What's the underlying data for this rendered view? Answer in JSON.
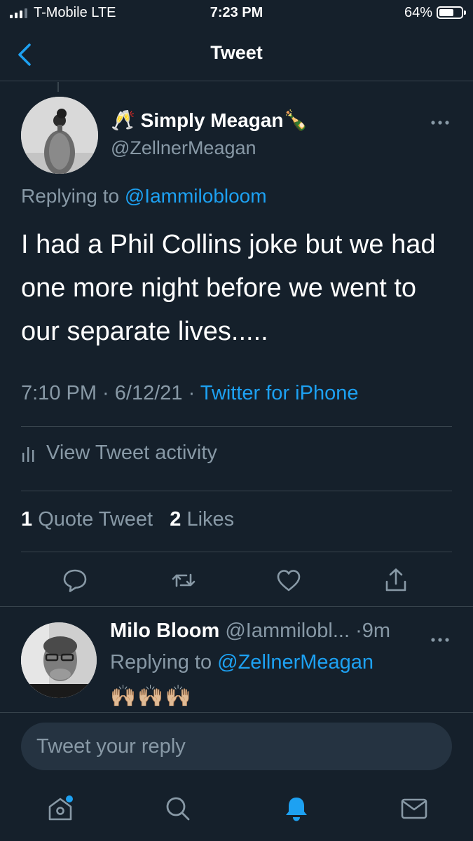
{
  "status_bar": {
    "carrier": "T-Mobile  LTE",
    "time": "7:23 PM",
    "battery": "64%",
    "battery_level": 0.64
  },
  "header": {
    "title": "Tweet",
    "back_icon": "chevron-left-icon"
  },
  "tweet": {
    "author_name": "🥂 Simply Meagan🍾",
    "author_handle": "@ZellnerMeagan",
    "more_icon": "ellipsis-icon",
    "replying_prefix": "Replying to ",
    "replying_handle": "@Iammilobloom",
    "text": "I had a Phil Collins joke but we had one more night before we went to our separate lives.....",
    "time": "7:10 PM",
    "date": "6/12/21",
    "source": "Twitter for iPhone",
    "activity_label": "View Tweet activity",
    "quote_count": "1",
    "quote_label": "Quote Tweet",
    "like_count": "2",
    "like_label": "Likes"
  },
  "actions": [
    "reply-icon",
    "retweet-icon",
    "like-icon",
    "share-icon"
  ],
  "reply": {
    "name": "Milo Bloom",
    "handle": "@Iammilobl...",
    "time": "·9m",
    "replying_prefix": "Replying to ",
    "replying_handle": "@ZellnerMeagan",
    "content": "🙌🏼🙌🏼🙌🏼"
  },
  "composer": {
    "placeholder": "Tweet your reply"
  },
  "tabs": [
    "home-icon",
    "search-icon",
    "notifications-icon",
    "messages-icon"
  ],
  "colors": {
    "background": "#15202b",
    "accent": "#1da1f2",
    "muted": "#8899a6",
    "divider": "#38444d"
  }
}
